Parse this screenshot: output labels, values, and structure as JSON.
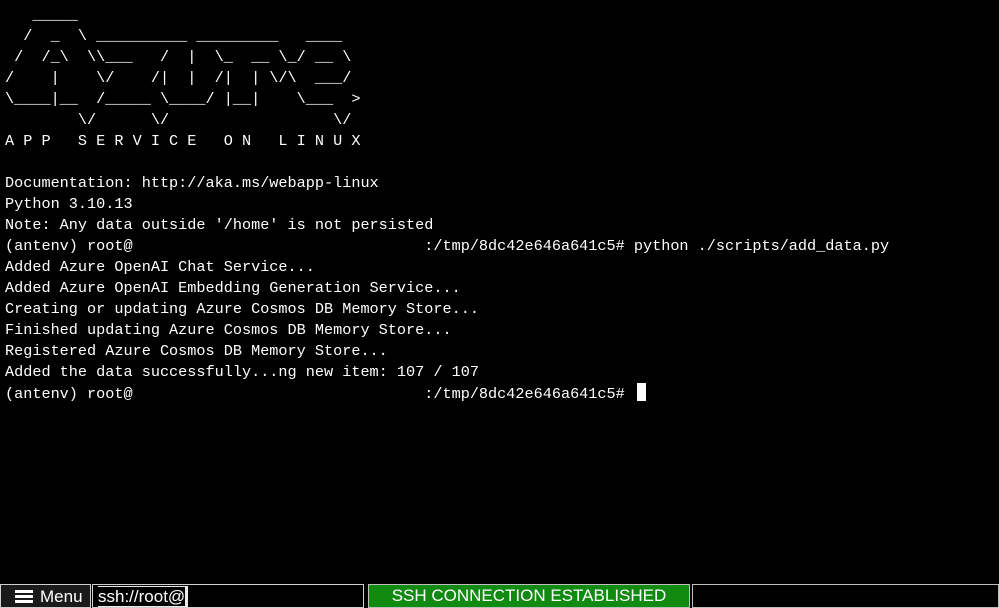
{
  "terminal": {
    "banner": [
      "   _____",
      "  /  _  \\ __________ _________   ____",
      " /  /_\\  \\\\___   /  |  \\_  __ \\_/ __ \\",
      "/    |    \\/    /|  |  /|  | \\/\\  ___/",
      "\\____|__  /_____ \\____/ |__|    \\___  >",
      "        \\/      \\/                  \\/",
      "A P P   S E R V I C E   O N   L I N U X"
    ],
    "lines": [
      "Documentation: http://aka.ms/webapp-linux",
      "Python 3.10.13",
      "Note: Any data outside '/home' is not persisted",
      "(antenv) root@                                :/tmp/8dc42e646a641c5# python ./scripts/add_data.py",
      "Added Azure OpenAI Chat Service...",
      "Added Azure OpenAI Embedding Generation Service...",
      "Creating or updating Azure Cosmos DB Memory Store...",
      "Finished updating Azure Cosmos DB Memory Store...",
      "Registered Azure Cosmos DB Memory Store...",
      "Added the data successfully...ng new item: 107 / 107"
    ],
    "prompt": "(antenv) root@                                :/tmp/8dc42e646a641c5# "
  },
  "statusbar": {
    "menu_label": "Menu",
    "menu_icon": "hamburger-icon",
    "connection_prefix": "ssh://root@",
    "connection_status": "SSH CONNECTION ESTABLISHED",
    "status_color": "#108a10"
  },
  "colors": {
    "background": "#000000",
    "foreground": "#ffffff"
  }
}
